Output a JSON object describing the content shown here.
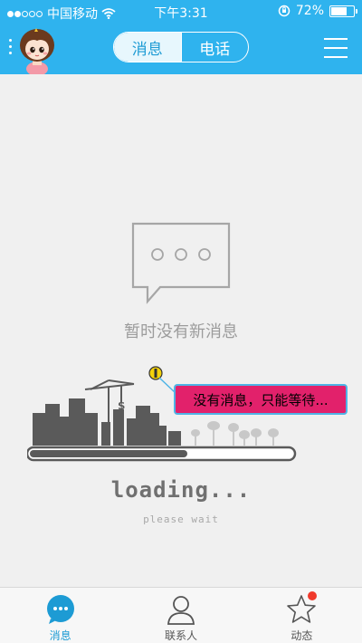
{
  "status_bar": {
    "carrier": "中国移动",
    "time": "下午3:31",
    "battery": "72%",
    "battery_level": 0.72,
    "signal_dots_filled": 2,
    "signal_dots_total": 5
  },
  "header": {
    "segments": [
      {
        "label": "消息",
        "active": true
      },
      {
        "label": "电话",
        "active": false
      }
    ]
  },
  "main": {
    "empty_text": "暂时没有新消息",
    "bubble_text": "没有消息，只能等待...",
    "loading_text": "loading...",
    "please_wait_text": "please wait",
    "loading_progress": 0.6
  },
  "tabbar": {
    "tabs": [
      {
        "label": "消息",
        "icon": "chat-bubble-icon",
        "active": true
      },
      {
        "label": "联系人",
        "icon": "contacts-icon",
        "active": false
      },
      {
        "label": "动态",
        "icon": "star-icon",
        "active": false,
        "badge": true
      }
    ]
  },
  "colors": {
    "header_bg": "#2fb3ee",
    "accent": "#1d9bd4",
    "bubble_bg": "#e2216b",
    "badge": "#f03a2c"
  }
}
